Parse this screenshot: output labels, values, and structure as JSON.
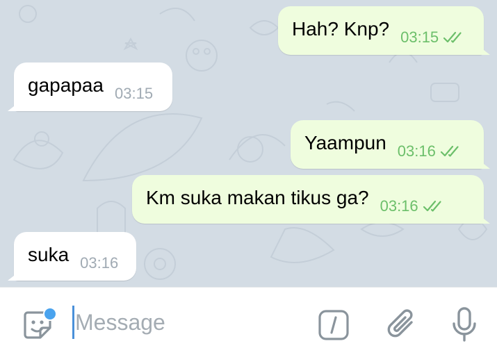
{
  "messages": [
    {
      "direction": "out",
      "text": "Hah? Knp?",
      "time": "03:15",
      "status": "read"
    },
    {
      "direction": "in",
      "text": "gapapaa",
      "time": "03:15"
    },
    {
      "direction": "out",
      "text": "Yaampun",
      "time": "03:16",
      "status": "read"
    },
    {
      "direction": "out",
      "text": "Km suka makan tikus ga?",
      "time": "03:16",
      "status": "read"
    },
    {
      "direction": "in",
      "text": "suka",
      "time": "03:16"
    }
  ],
  "input": {
    "placeholder": "Message",
    "value": ""
  },
  "icons": {
    "sticker": "sticker-icon",
    "bot_commands": "slash-command-icon",
    "attach": "paperclip-icon",
    "voice": "microphone-icon",
    "read_receipt": "double-check-icon"
  },
  "colors": {
    "chat_background": "#d3dce4",
    "incoming_bubble": "#ffffff",
    "outgoing_bubble": "#effdde",
    "outgoing_time": "#6cbf6a",
    "incoming_time": "#a0aab3",
    "notification_dot": "#4aa3ee",
    "icon_gray": "#8a949c"
  }
}
